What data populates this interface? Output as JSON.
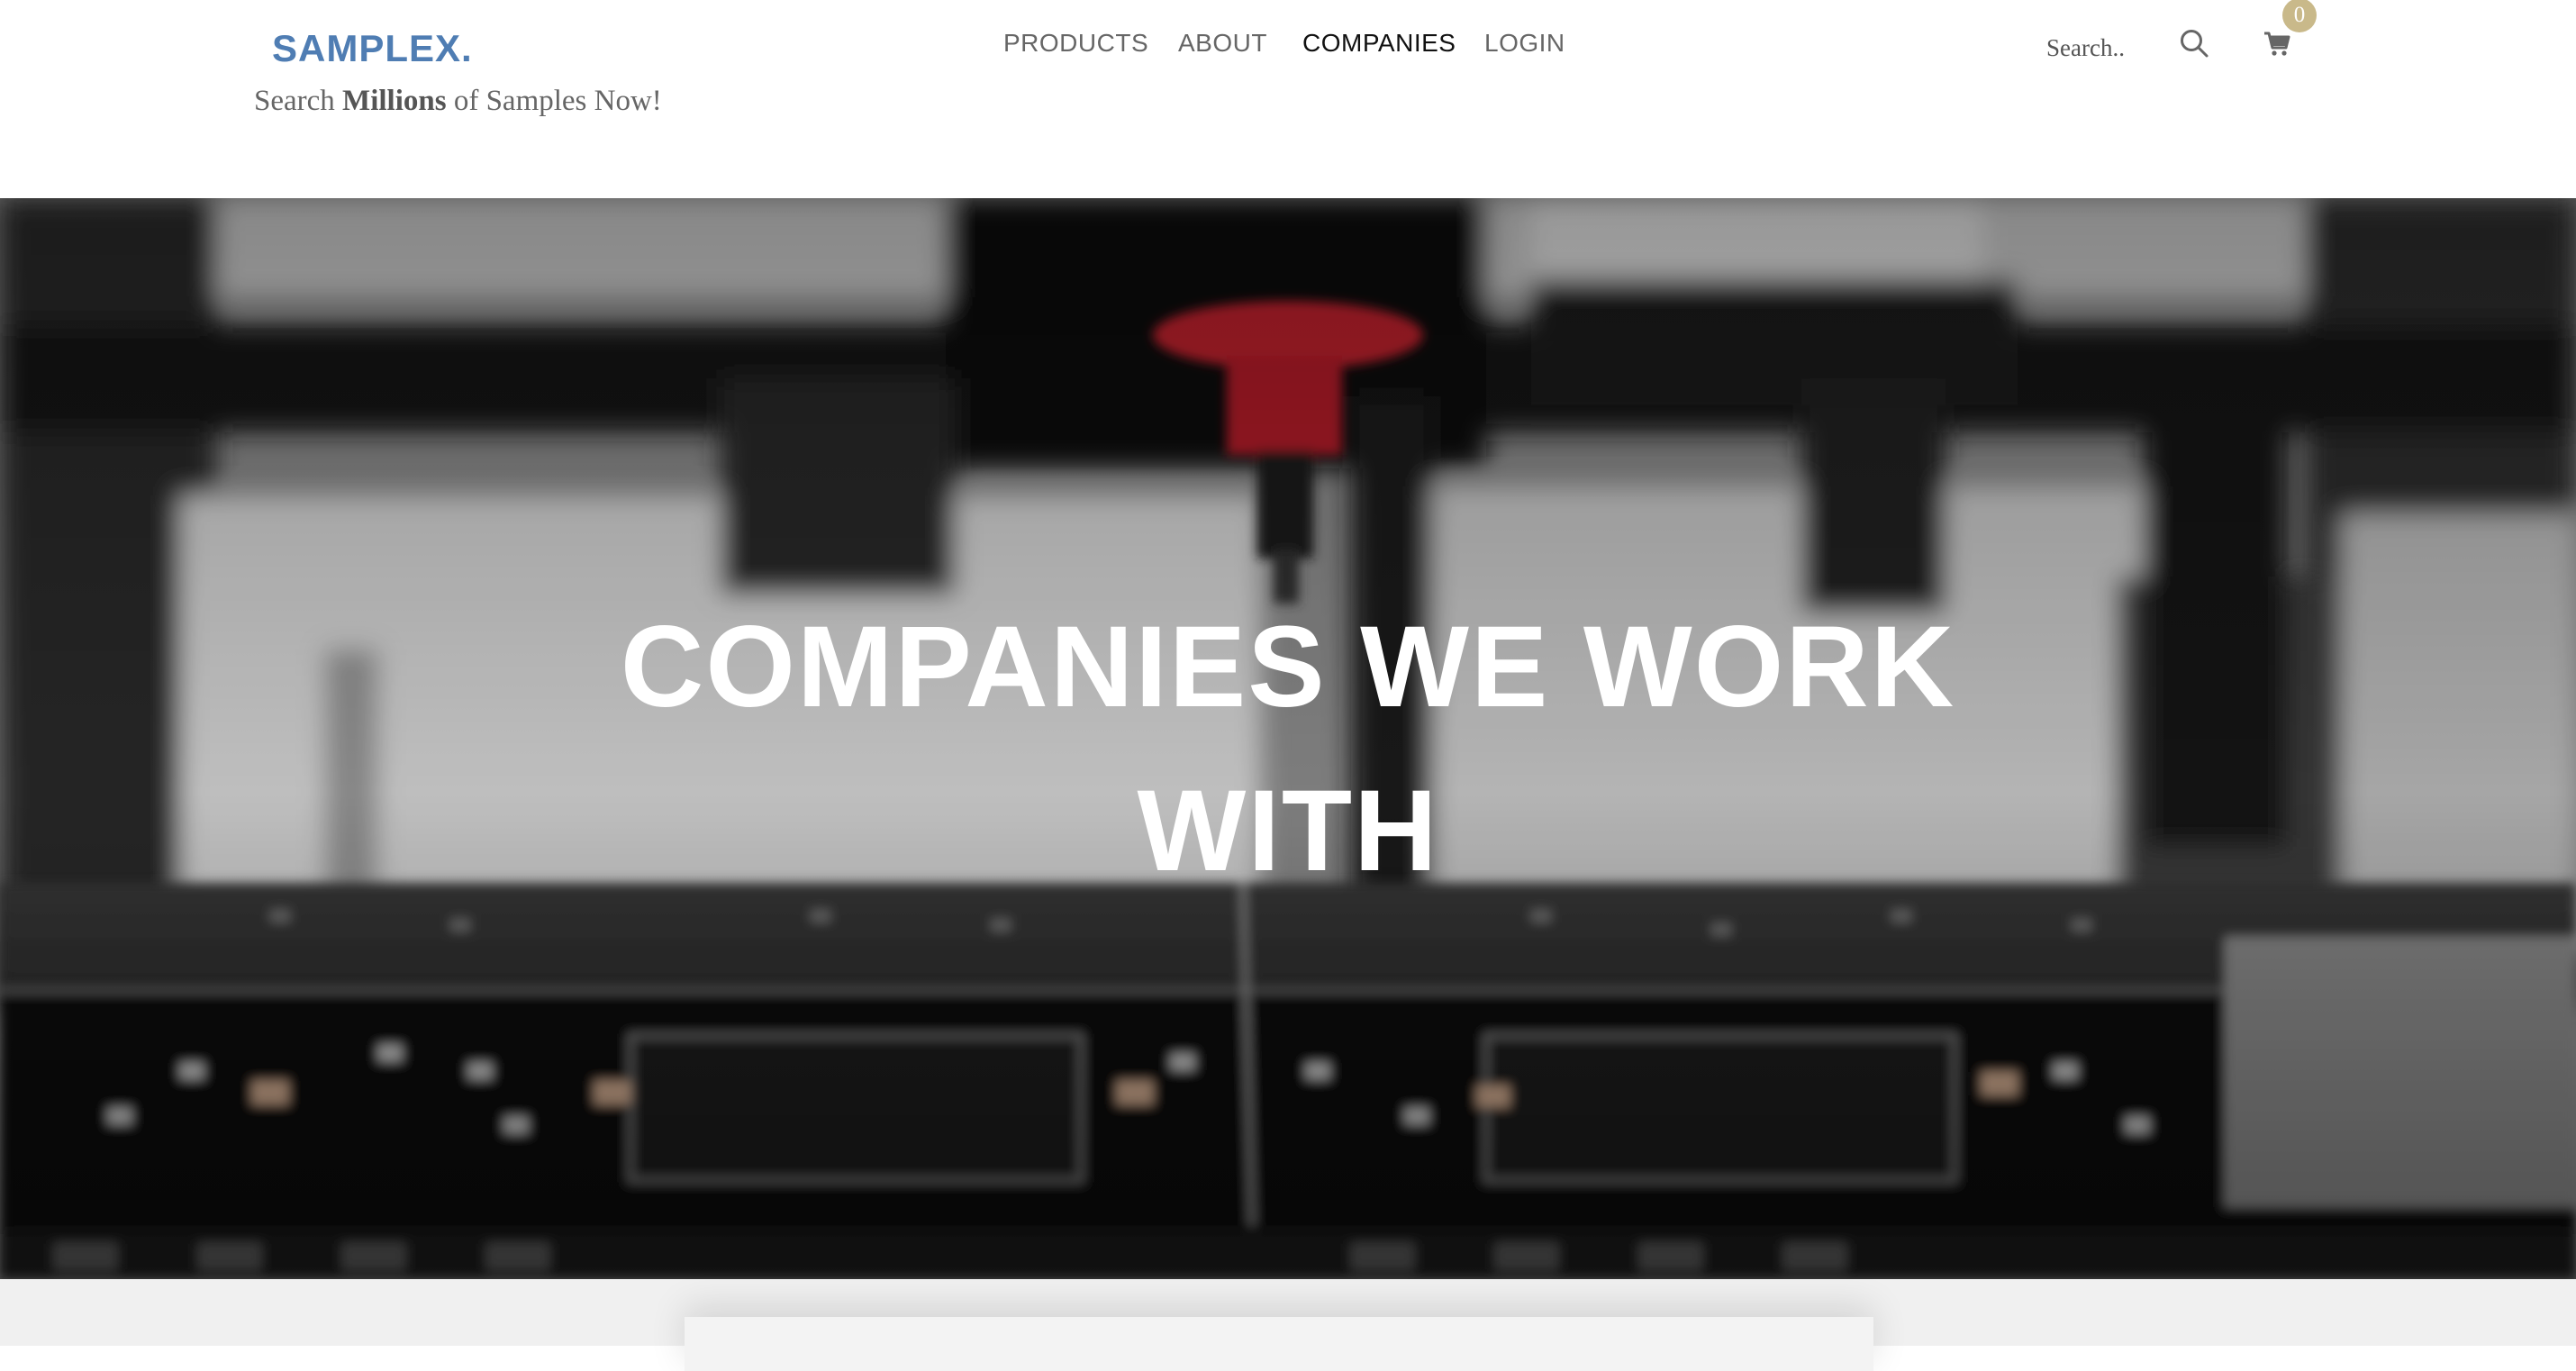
{
  "brand": {
    "logo": "SAMPLEX.",
    "tagline_pre": "Search ",
    "tagline_bold": "Millions",
    "tagline_post": " of Samples Now!",
    "color": "#4f7db3"
  },
  "nav": {
    "items": [
      {
        "label": "PRODUCTS",
        "active": false
      },
      {
        "label": "ABOUT",
        "active": false
      },
      {
        "label": "COMPANIES",
        "active": true
      },
      {
        "label": "LOGIN",
        "active": false
      }
    ]
  },
  "search": {
    "placeholder": "Search..",
    "icon": "search-icon"
  },
  "cart": {
    "icon": "cart-icon",
    "count": "0",
    "badge_color": "#c9b98a"
  },
  "hero": {
    "title": "COMPANIES WE WORK WITH",
    "image": "blurred-circuit-board-pick-and-place-machine"
  }
}
